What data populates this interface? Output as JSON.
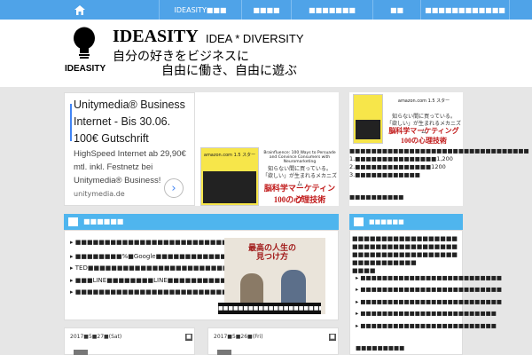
{
  "nav": {
    "home_icon": "home-icon",
    "items": [
      "IDEASITY■■■",
      "■■■■",
      "■■■■■■■",
      "■■",
      "■■■■■■■■■■■■"
    ]
  },
  "header": {
    "logo_word": "IDEASITY",
    "title": "IDEASITY",
    "subtitle": "IDEA * DIVERSITY",
    "tagline1": "自分の好きをビジネスに",
    "tagline2": "自由に働き、自由に遊ぶ"
  },
  "ad": {
    "title": "Unitymedia® Business Internet - Bis 30.06. 100€ Gutschrift",
    "description": "HighSpeed Internet ab 29,90€ mtl. inkl. Festnetz bei Unitymedia® Business!",
    "url": "unitymedia.de",
    "arrow": "›"
  },
  "book": {
    "label": "amazon.com 1.5 スター",
    "subtitle_en": "Brainfluence: 100 Ways to Persuade and Convince Consumers with Neuromarketing",
    "catch1": "知らない間に買っている。",
    "catch2": "「欲しい」が生まれるメカニズム",
    "title_line1": "脳科学マーケティング",
    "title_line2": "100の心理技術"
  },
  "main_section": {
    "title": "■■■■■■",
    "items": [
      "■■■■■■■■■■■■■■■■■■■■■■■■■■■■3■■■■",
      "■■■■■■■■%■Google■■■■■■■■■■■■",
      "TED■■■■■■■■■■■■■■■■■■■■■■■■■■■3■■■■",
      "■■■LINE■■■■■■■■LINE■■■■■■■■■■■■■■■",
      "■■■■■■■■■■■■■■■■■■■■■■■■■■■■■■"
    ],
    "photo_caption": "■■■■■■■■■■■■■■■■■■■■■■■■■■■■■■",
    "photo_title": "最高の人生の見つけ方"
  },
  "cards": [
    {
      "date": "2017■5■27■(Sat)",
      "badge": "■"
    },
    {
      "date": "2017■5■26■(Fri)",
      "badge": "■"
    }
  ],
  "sidebar": {
    "desc": "■■■■■■■■■■■■■■■■■■■■■■■■■■■■■■■■■",
    "lines": [
      "1.■■■■■■■■■■■■■■■1,200",
      "2.■■■■■■■■■■■■■■1200",
      "3.■■■■■■■■■■■■"
    ],
    "link": "■■■■■■■■■■",
    "section_title": "■■■■■■",
    "para": "■■■■■■■■■■■■■■■■■■■■■■■■■■■■■■■■■■■■■■■■■■■■■■■■■■■■■■■■■■■■■■■■■",
    "para_tail": "■■■■",
    "items": [
      "■■■■■■■■■■■■■■■■■■■■■■■■■■",
      "■■■■■■■■■■■■■■■■■■■■■■■■■■",
      "■■■■■■■■■■■■■■■■■■■■■■■■■■",
      "■■■■■■■■■■■■■■■■■■■■■■■■■",
      "■■■■■■■■■■■■■■■■■■■■■■■■■"
    ],
    "more": "■■■■■■■■■"
  }
}
